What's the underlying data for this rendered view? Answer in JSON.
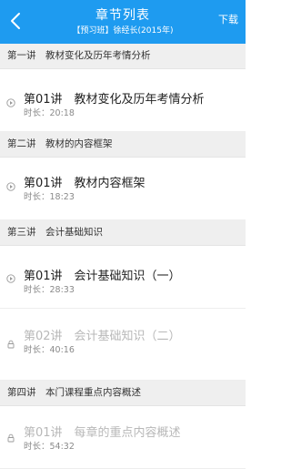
{
  "header": {
    "title": "章节列表",
    "subtitle": "【预习班】徐经长(2015年)",
    "download_label": "下载",
    "bg_color": "#1e9bf0"
  },
  "sections": [
    {
      "title": "第一讲　教材变化及历年考情分析",
      "items": [
        {
          "title": "第01讲　教材变化及历年考情分析",
          "duration": "时长：20:18",
          "state": "playable",
          "icon": "play-icon"
        }
      ]
    },
    {
      "title": "第二讲　教材的内容框架",
      "items": [
        {
          "title": "第01讲　教材内容框架",
          "duration": "时长：18:23",
          "state": "playable",
          "icon": "play-icon"
        }
      ]
    },
    {
      "title": "第三讲　会计基础知识",
      "items": [
        {
          "title": "第01讲　会计基础知识（一）",
          "duration": "时长：28:33",
          "state": "playable",
          "icon": "play-icon"
        },
        {
          "title": "第02讲　会计基础知识（二）",
          "duration": "时长：40:16",
          "state": "locked",
          "icon": "lock-icon"
        }
      ]
    },
    {
      "title": "第四讲　本门课程重点内容概述",
      "items": [
        {
          "title": "第01讲　每章的重点内容概述",
          "duration": "时长：54:32",
          "state": "locked",
          "icon": "lock-icon"
        }
      ]
    }
  ]
}
